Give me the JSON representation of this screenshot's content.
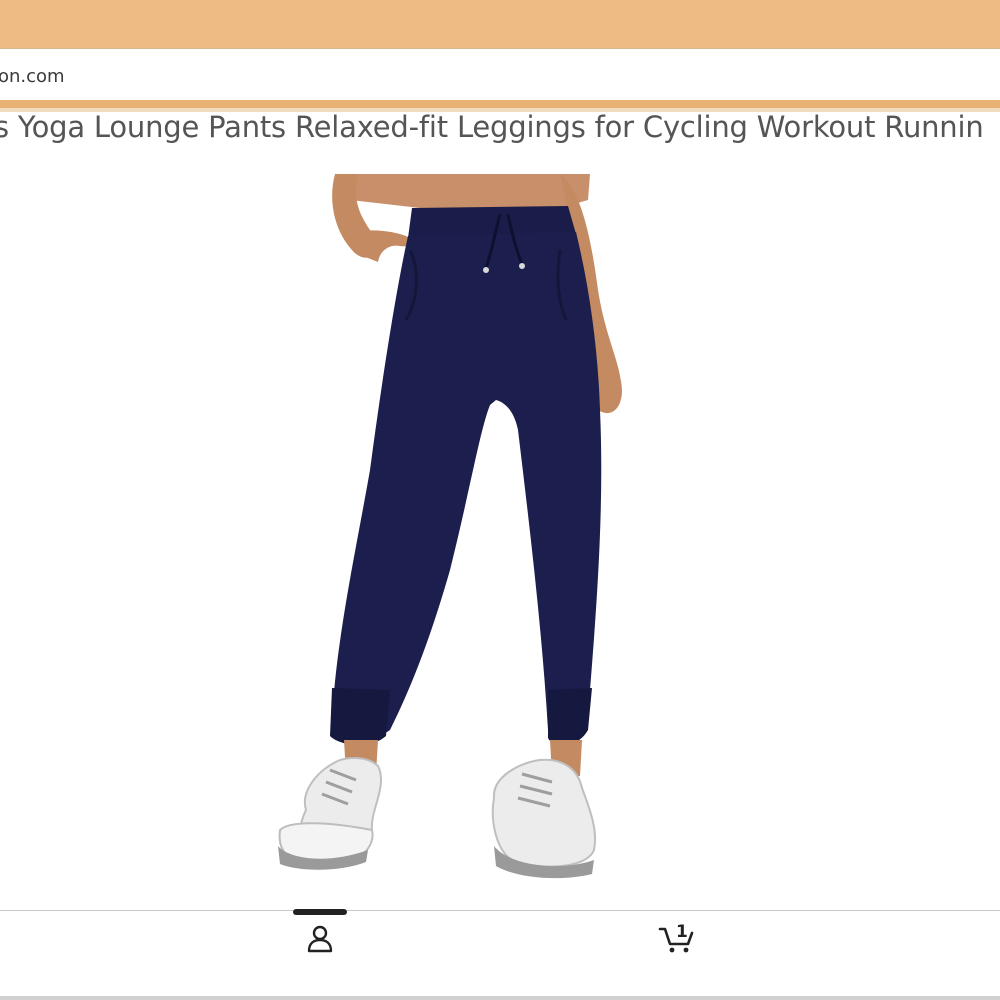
{
  "browser": {
    "url_text": "on.com",
    "header_color": "#EDBB83",
    "accent_color": "#E3A45A"
  },
  "product": {
    "title": "s Yoga Lounge Pants Relaxed-fit Leggings for Cycling Workout Runnin",
    "image_alt": "navy jogger pants",
    "pants_color": "#1c1f4e"
  },
  "bottom_nav": {
    "items": [
      {
        "icon": "profile-icon",
        "active": true
      },
      {
        "icon": "cart-icon",
        "badge": "1"
      }
    ]
  }
}
